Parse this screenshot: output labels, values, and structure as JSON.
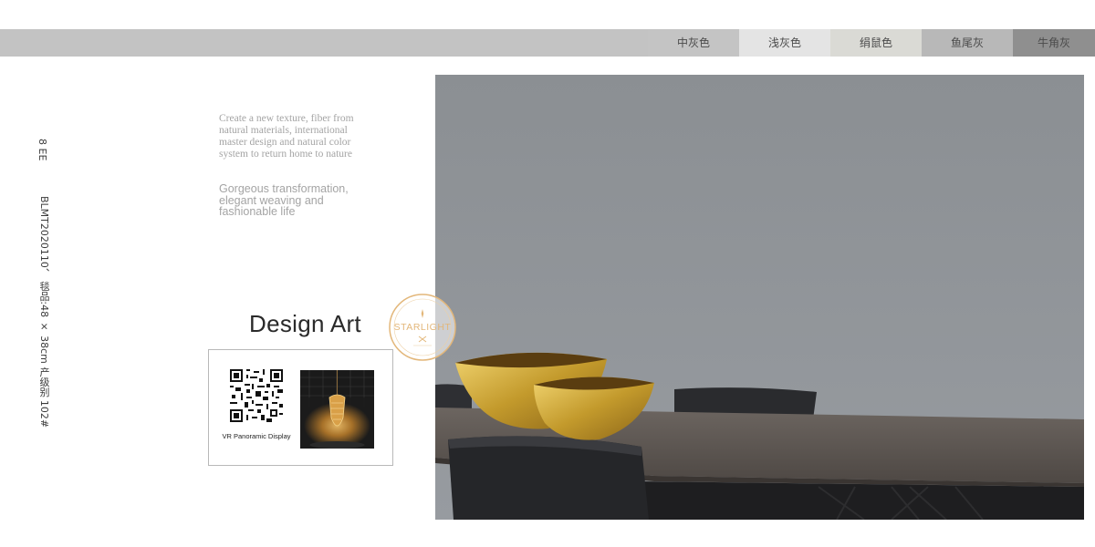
{
  "swatches": [
    {
      "label": "中灰色",
      "color": "#c4c4c4"
    },
    {
      "label": "浅灰色",
      "color": "#e4e4e4"
    },
    {
      "label": "绢鼠色",
      "color": "#dadad5"
    },
    {
      "label": "鱼尾灰",
      "color": "#b8b8b8"
    },
    {
      "label": "牛角灰",
      "color": "#8f8f8f"
    }
  ],
  "side": {
    "page_number": "8 EE",
    "product_info": "BLMT2020110、 毯品:48 × 38cm 产级别 102#"
  },
  "intro_serif": "Create a new texture, fiber from natural materials, international master design and natural color system to return home to nature",
  "intro_sans": "Gorgeous transformation, elegant weaving and fashionable life",
  "title": "Design Art",
  "card": {
    "qr_caption": "VR Panoramic Display"
  },
  "badge": {
    "text": "STARLIGHT"
  }
}
